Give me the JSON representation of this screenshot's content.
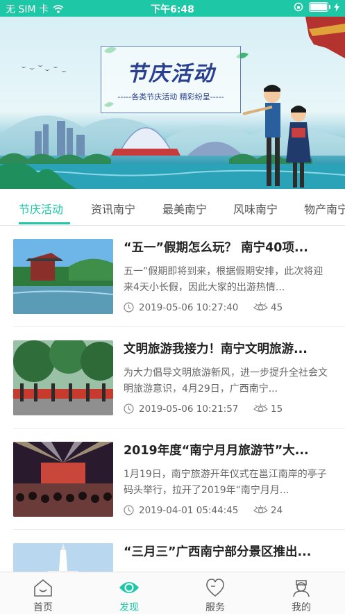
{
  "status_bar": {
    "carrier": "无 SIM 卡",
    "time": "下午6:48",
    "battery_level": 1.0
  },
  "banner": {
    "title": "节庆活动",
    "subtitle": "-----各类节庆活动 精彩纷呈-----"
  },
  "tabs": [
    {
      "label": "节庆活动",
      "active": true
    },
    {
      "label": "资讯南宁",
      "active": false
    },
    {
      "label": "最美南宁",
      "active": false
    },
    {
      "label": "风味南宁",
      "active": false
    },
    {
      "label": "物产南宁",
      "active": false
    }
  ],
  "articles": [
    {
      "title": "“五一”假期怎么玩？ 南宁40项...",
      "description": "五一”假期即将到来，根据假期安排，此次将迎来4天小长假，因此大家的出游热情...",
      "date": "2019-05-06 10:27:40",
      "views": "45"
    },
    {
      "title": "文明旅游我接力！南宁文明旅游...",
      "description": "为大力倡导文明旅游新风，进一步提升全社会文明旅游意识，4月29日，广西南宁...",
      "date": "2019-05-06 10:21:57",
      "views": "15"
    },
    {
      "title": "2019年度“南宁月月旅游节”大...",
      "description": "1月19日，南宁旅游开年仪式在邕江南岸的亭子码头举行，拉开了2019年“南宁月月...",
      "date": "2019-04-01 05:44:45",
      "views": "24"
    },
    {
      "title": "“三月三”广西南宁部分景区推出...",
      "description": "",
      "date": "",
      "views": ""
    }
  ],
  "bottom_nav": [
    {
      "label": "首页",
      "icon": "home-icon",
      "active": false
    },
    {
      "label": "发现",
      "icon": "discover-eye-icon",
      "active": true
    },
    {
      "label": "服务",
      "icon": "heart-icon",
      "active": false
    },
    {
      "label": "我的",
      "icon": "user-icon",
      "active": false
    }
  ],
  "colors": {
    "accent": "#1ec7a6",
    "text": "#222222",
    "muted": "#666666"
  }
}
